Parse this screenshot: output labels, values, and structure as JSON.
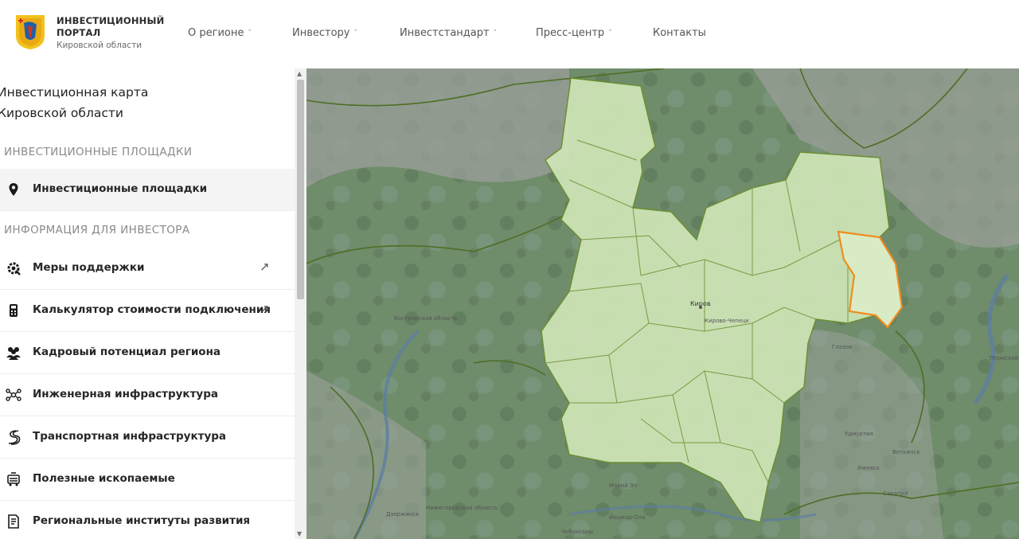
{
  "header": {
    "brand": {
      "line1": "ИНВЕСТИЦИОННЫЙ",
      "line2": "ПОРТАЛ",
      "line3": "Кировской области"
    },
    "nav": [
      {
        "label": "О регионе",
        "has_dropdown": true
      },
      {
        "label": "Инвестору",
        "has_dropdown": true
      },
      {
        "label": "Инвестстандарт",
        "has_dropdown": true
      },
      {
        "label": "Пресс-центр",
        "has_dropdown": true
      },
      {
        "label": "Контакты",
        "has_dropdown": false
      }
    ],
    "chevron": "˅"
  },
  "sidebar": {
    "title_line1": "Инвестиционная карта",
    "title_line2": "Кировской области",
    "section1": "ИНВЕСТИЦИОННЫЕ ПЛОЩАДКИ",
    "section2": "ИНФОРМАЦИЯ ДЛЯ ИНВЕСТОРА",
    "items": [
      {
        "label": "Инвестиционные площадки",
        "icon": "map-pin-icon",
        "external": false,
        "active": true
      },
      {
        "label": "Меры поддержки",
        "icon": "support-gear-icon",
        "external": true
      },
      {
        "label": "Калькулятор стоимости подключения",
        "icon": "calculator-icon",
        "external": true
      },
      {
        "label": "Кадровый потенциал региона",
        "icon": "people-icon",
        "external": false
      },
      {
        "label": "Инженерная инфраструктура",
        "icon": "network-icon",
        "external": false
      },
      {
        "label": "Транспортная инфраструктура",
        "icon": "road-icon",
        "external": false
      },
      {
        "label": "Полезные ископаемые",
        "icon": "mining-icon",
        "external": false
      },
      {
        "label": "Региональные институты развития",
        "icon": "document-icon",
        "external": false
      }
    ],
    "external_glyph": "↗"
  },
  "scrollbar": {
    "up": "▲",
    "down": "▼"
  },
  "map": {
    "labels": {
      "kirov": "Киров",
      "kirovo_chepetsk": "Кирово-Чепецк",
      "kostroma": "Костромская область",
      "glazov": "Глазов",
      "udmurtia": "Удмуртия",
      "izhevsk": "Ижевск",
      "yoshkar_ola": "Йошкар-Ола",
      "cheboksary": "Чебоксары",
      "mari_el": "Марий Эл",
      "nizhny": "Нижегородская область",
      "dzerzhinsk": "Дзержинск",
      "perm": "Пермский",
      "sarapul": "Сарапул",
      "votkinsk": "Воткинск"
    },
    "colors": {
      "region_fill": "#cfe5b7",
      "region_border": "#6b8f2e",
      "highlight": "#f08c1e",
      "background": "#6d8a6a"
    }
  }
}
